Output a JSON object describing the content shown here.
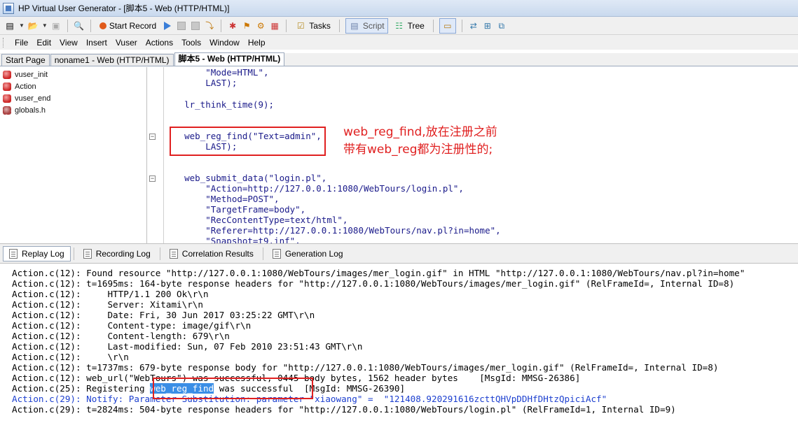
{
  "window": {
    "title": "HP Virtual User Generator - [脚本5 - Web (HTTP/HTML)]"
  },
  "toolbar": {
    "start_record": "Start Record",
    "tasks": "Tasks",
    "script": "Script",
    "tree": "Tree"
  },
  "menu": [
    "File",
    "Edit",
    "View",
    "Insert",
    "Vuser",
    "Actions",
    "Tools",
    "Window",
    "Help"
  ],
  "tabs": [
    "Start Page",
    "noname1 - Web (HTTP/HTML)",
    "脚本5 - Web (HTTP/HTML)"
  ],
  "tree": [
    "vuser_init",
    "Action",
    "vuser_end",
    "globals.h"
  ],
  "editor": {
    "lines": [
      "        \"Mode=HTML\",",
      "        LAST);",
      "",
      "    lr_think_time(9);",
      "",
      "",
      "    web_reg_find(\"Text=admin\",",
      "        LAST);",
      "",
      "",
      "    web_submit_data(\"login.pl\",",
      "        \"Action=http://127.0.0.1:1080/WebTours/login.pl\",",
      "        \"Method=POST\",",
      "        \"TargetFrame=body\",",
      "        \"RecContentType=text/html\",",
      "        \"Referer=http://127.0.0.1:1080/WebTours/nav.pl?in=home\",",
      "        \"Snapshot=t9.inf\","
    ],
    "annotation_line1": "web_reg_find,放在注册之前",
    "annotation_line2": "带有web_reg都为注册性的;"
  },
  "log_tabs": [
    "Replay Log",
    "Recording Log",
    "Correlation Results",
    "Generation Log"
  ],
  "log": {
    "lines": [
      "Action.c(12): Found resource \"http://127.0.0.1:1080/WebTours/images/mer_login.gif\" in HTML \"http://127.0.0.1:1080/WebTours/nav.pl?in=home\"",
      "Action.c(12): t=1695ms: 164-byte response headers for \"http://127.0.0.1:1080/WebTours/images/mer_login.gif\" (RelFrameId=, Internal ID=8)",
      "Action.c(12):     HTTP/1.1 200 Ok\\r\\n",
      "Action.c(12):     Server: Xitami\\r\\n",
      "Action.c(12):     Date: Fri, 30 Jun 2017 03:25:22 GMT\\r\\n",
      "Action.c(12):     Content-type: image/gif\\r\\n",
      "Action.c(12):     Content-length: 679\\r\\n",
      "Action.c(12):     Last-modified: Sun, 07 Feb 2010 23:51:43 GMT\\r\\n",
      "Action.c(12):     \\r\\n",
      "Action.c(12): t=1737ms: 679-byte response body for \"http://127.0.0.1:1080/WebTours/images/mer_login.gif\" (RelFrameId=, Internal ID=8)",
      "Action.c(12): web_url(\"WebTours\") was successful, 0445 body bytes, 1562 header bytes    [MsgId: MMSG-26386]",
      "Action.c(25): Registering ",
      "Action.c(29): Notify: Parameter Substitution: parameter \"xiaowang\" =  \"121408.920291616zcttQHVpDDHfDHtzQpiciAcf\"",
      "Action.c(29): t=2824ms: 504-byte response headers for \"http://127.0.0.1:1080/WebTours/login.pl\" (RelFrameId=1, Internal ID=9)"
    ],
    "highlight": "web_reg_find",
    "registering_tail": " was successful",
    "registering_msg": "  [MsgId: MMSG-26390]"
  }
}
